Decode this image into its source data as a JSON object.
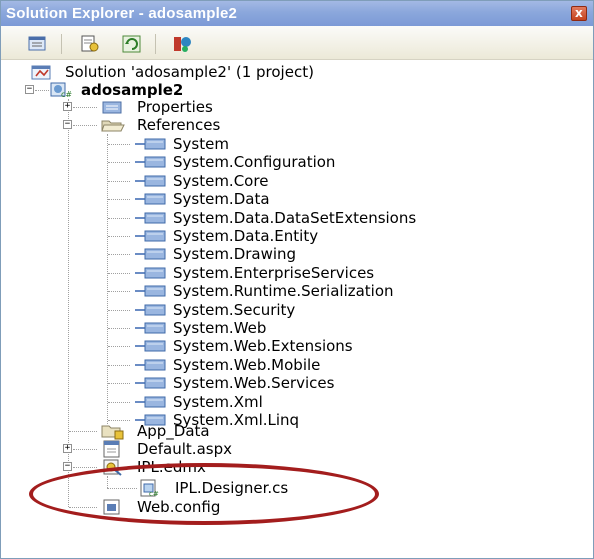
{
  "window": {
    "title": "Solution Explorer - adosample2",
    "close_glyph": "x"
  },
  "toolbar": {
    "buttons": [
      {
        "name": "show-all-files",
        "icon": "show-all-files-icon"
      },
      {
        "name": "properties",
        "icon": "properties-icon"
      },
      {
        "name": "refresh",
        "icon": "refresh-icon"
      },
      {
        "name": "view-class-diagram",
        "icon": "class-diagram-icon"
      }
    ]
  },
  "tree": {
    "solution": "Solution 'adosample2' (1 project)",
    "project": "adosample2",
    "properties": "Properties",
    "references_label": "References",
    "references": [
      "System",
      "System.Configuration",
      "System.Core",
      "System.Data",
      "System.Data.DataSetExtensions",
      "System.Data.Entity",
      "System.Drawing",
      "System.EnterpriseServices",
      "System.Runtime.Serialization",
      "System.Security",
      "System.Web",
      "System.Web.Extensions",
      "System.Web.Mobile",
      "System.Web.Services",
      "System.Xml",
      "System.Xml.Linq"
    ],
    "app_data": "App_Data",
    "default_aspx": "Default.aspx",
    "edmx": "IPL.edmx",
    "designer": "IPL.Designer.cs",
    "web_config": "Web.config"
  },
  "colors": {
    "title_bar": "#8ba7dc",
    "highlight_ellipse": "#a31d1d"
  }
}
